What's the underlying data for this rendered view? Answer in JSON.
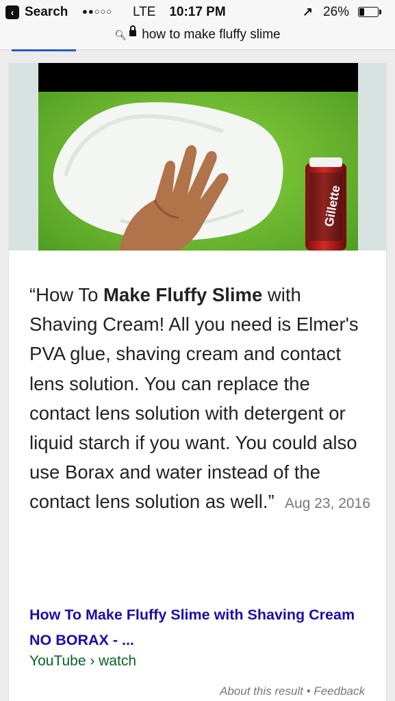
{
  "status_bar": {
    "back_label": "Search",
    "signal": "●●○○○",
    "network": "LTE",
    "time": "10:17 PM",
    "battery": "26%",
    "battery_level": 0.26
  },
  "url_bar": {
    "query": "how to make fluffy slime"
  },
  "featured_snippet": {
    "quote_open": "“How To ",
    "bold": "Make Fluffy Slime",
    "body": " with Shaving Cream! All you need is Elmer's PVA glue, shaving cream and contact lens solution. You can replace the contact lens solution with detergent or liquid starch if you want. You could also use Borax and water instead of the contact lens solution as well.”",
    "date": "Aug 23, 2016"
  },
  "result": {
    "title": "How To Make Fluffy Slime with Shaving Cream NO BORAX - ...",
    "url": "YouTube › watch"
  },
  "footer": {
    "about": "About this result",
    "separator": "•",
    "feedback": "Feedback"
  },
  "image": {
    "can_brand": "Gillette"
  }
}
